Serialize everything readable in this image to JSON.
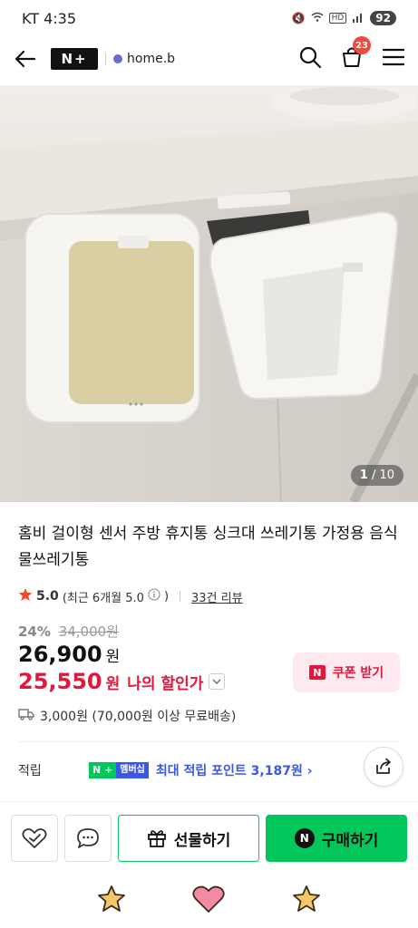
{
  "status": {
    "carrier_time": "KT 4:35",
    "battery": "92",
    "net": "HD"
  },
  "header": {
    "brand": "N+",
    "store": "home.b",
    "cart_count": "23"
  },
  "gallery": {
    "current": "1",
    "total": "/ 10"
  },
  "product": {
    "title": "홈비 걸이형 센서 주방 휴지통 싱크대 쓰레기통 가정용 음식물쓰레기통",
    "rating": "5.0",
    "rating_detail": "(최근 6개월 5.0",
    "rating_close": ")",
    "reviews": "33건 리뷰",
    "discount_pct": "24%",
    "original_price": "34,000원",
    "price": "26,900",
    "price_unit": "원",
    "my_price": "25,550",
    "my_price_unit": "원",
    "my_price_label": "나의 할인가",
    "coupon_label": "쿠폰 받기",
    "coupon_icon": "N",
    "shipping": "3,000원 (70,000원 이상 무료배송)",
    "points_label": "적립",
    "membership_n": "N +",
    "membership_tag": "멤버십",
    "points_text": "최대 적립 포인트 3,187원 ›"
  },
  "actions": {
    "gift": "선물하기",
    "buy": "구매하기",
    "buy_icon": "N"
  },
  "colors": {
    "naver_green": "#03c75a",
    "sale_red": "#e3163b",
    "membership_blue": "#3b57e6"
  }
}
